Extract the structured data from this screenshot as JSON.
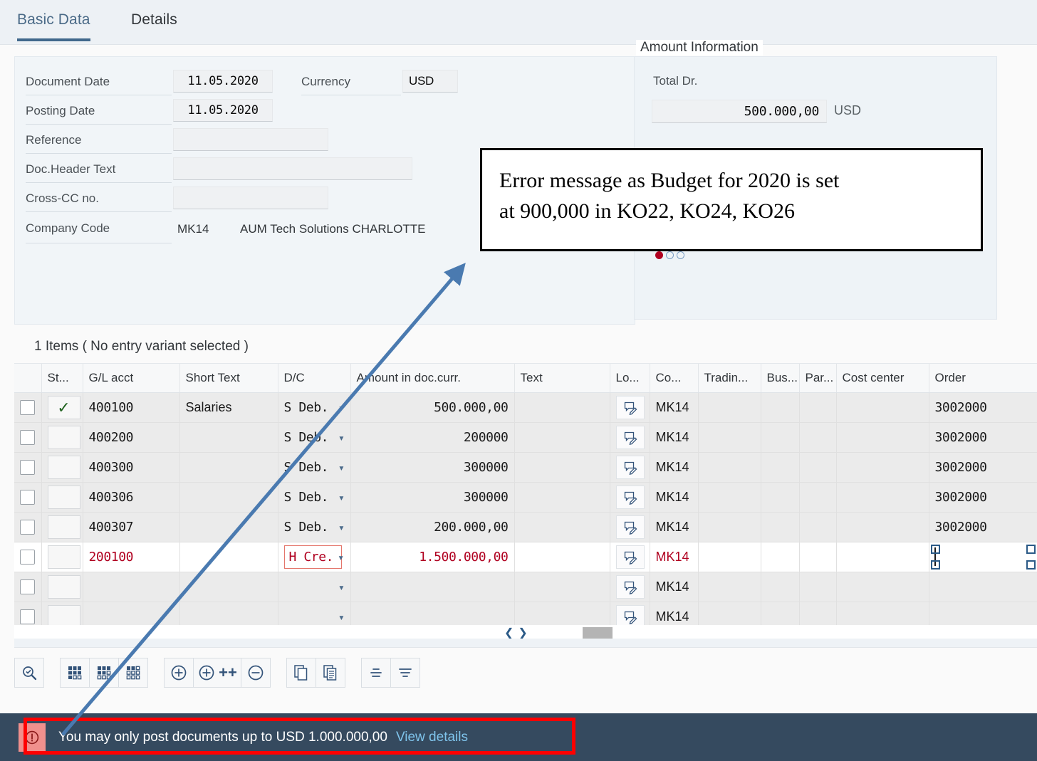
{
  "tabs": [
    {
      "label": "Basic Data",
      "active": true
    },
    {
      "label": "Details",
      "active": false
    }
  ],
  "form": {
    "fields": [
      {
        "label": "Document Date",
        "value": "11.05.2020"
      },
      {
        "label": "Posting Date",
        "value": "11.05.2020"
      },
      {
        "label": "Reference",
        "value": ""
      },
      {
        "label": "Doc.Header Text",
        "value": ""
      },
      {
        "label": "Cross-CC no.",
        "value": ""
      }
    ],
    "currency_label": "Currency",
    "currency_value": "USD",
    "company_code_label": "Company Code",
    "company_code": "MK14",
    "company_name": "AUM Tech Solutions CHARLOTTE"
  },
  "amount_information": {
    "title": "Amount Information",
    "total_label": "Total Dr.",
    "total_value": "500.000,00",
    "currency": "USD",
    "pagination": {
      "total": 3,
      "active": 1
    }
  },
  "items": {
    "title": "1 Items ( No entry variant selected )",
    "columns": [
      "",
      "St...",
      "G/L acct",
      "Short Text",
      "D/C",
      "Amount in doc.curr.",
      "Text",
      "Lo...",
      "Co...",
      "Tradin...",
      "Bus...",
      "Par...",
      "Cost center",
      "Order"
    ],
    "rows": [
      {
        "status": "check",
        "gl": "400100",
        "short_text": "Salaries",
        "dc": "S Deb.",
        "amount": "500.000,00",
        "text": "",
        "note_icon": "note-edit-icon",
        "co": "MK14",
        "trading": "",
        "bus": "",
        "par": "",
        "cost_center": "",
        "order": "3002000",
        "error": false,
        "focused": false
      },
      {
        "status": "",
        "gl": "400200",
        "short_text": "",
        "dc": "S Deb.",
        "amount": "200000",
        "text": "",
        "note_icon": "note-edit-icon",
        "co": "MK14",
        "trading": "",
        "bus": "",
        "par": "",
        "cost_center": "",
        "order": "3002000",
        "error": false,
        "focused": false
      },
      {
        "status": "",
        "gl": "400300",
        "short_text": "",
        "dc": "S Deb.",
        "amount": "300000",
        "text": "",
        "note_icon": "note-edit-icon",
        "co": "MK14",
        "trading": "",
        "bus": "",
        "par": "",
        "cost_center": "",
        "order": "3002000",
        "error": false,
        "focused": false
      },
      {
        "status": "",
        "gl": "400306",
        "short_text": "",
        "dc": "S Deb.",
        "amount": "300000",
        "text": "",
        "note_icon": "note-edit-icon",
        "co": "MK14",
        "trading": "",
        "bus": "",
        "par": "",
        "cost_center": "",
        "order": "3002000",
        "error": false,
        "focused": false
      },
      {
        "status": "",
        "gl": "400307",
        "short_text": "",
        "dc": "S Deb.",
        "amount": "200.000,00",
        "text": "",
        "note_icon": "note-edit-icon",
        "co": "MK14",
        "trading": "",
        "bus": "",
        "par": "",
        "cost_center": "",
        "order": "3002000",
        "error": false,
        "focused": false
      },
      {
        "status": "",
        "gl": "200100",
        "short_text": "",
        "dc": "H Cre.",
        "amount": "1.500.000,00",
        "text": "",
        "note_icon": "note-edit-icon",
        "co": "MK14",
        "trading": "",
        "bus": "",
        "par": "",
        "cost_center": "",
        "order": "",
        "error": true,
        "focused": true
      },
      {
        "status": "",
        "gl": "",
        "short_text": "",
        "dc": "",
        "amount": "",
        "text": "",
        "note_icon": "note-edit-icon",
        "co": "MK14",
        "trading": "",
        "bus": "",
        "par": "",
        "cost_center": "",
        "order": "",
        "error": false,
        "focused": false
      },
      {
        "status": "",
        "gl": "",
        "short_text": "",
        "dc": "",
        "amount": "",
        "text": "",
        "note_icon": "note-edit-icon",
        "co": "MK14",
        "trading": "",
        "bus": "",
        "par": "",
        "cost_center": "",
        "order": "",
        "error": false,
        "focused": false
      }
    ]
  },
  "toolbar": {
    "groups": [
      [
        {
          "name": "find-icon"
        }
      ],
      [
        {
          "name": "select-all-layout-icon"
        },
        {
          "name": "select-block-layout-icon"
        },
        {
          "name": "deselect-layout-icon"
        }
      ],
      [
        {
          "name": "add-row-icon"
        },
        {
          "name": "add-multiple-rows-icon",
          "label": "++"
        },
        {
          "name": "delete-row-icon"
        }
      ],
      [
        {
          "name": "copy-icon"
        },
        {
          "name": "paste-icon"
        }
      ],
      [
        {
          "name": "align-summary-icon"
        },
        {
          "name": "sort-icon"
        }
      ]
    ]
  },
  "message": {
    "icon": "error-icon",
    "text": "You may only post documents up to USD 1.000.000,00",
    "link": "View details"
  },
  "annotation": {
    "callout_line1": "Error message as Budget for 2020 is set",
    "callout_line2": "at 900,000 in KO22, KO24, KO26"
  },
  "colors": {
    "accent_blue": "#41688c",
    "error_red": "#b00020",
    "annotation_red": "#ff0000",
    "arrow_blue": "#4a7ab0",
    "message_bar": "#354a5f",
    "link_blue": "#7fc4ec",
    "success_green": "#216320"
  }
}
